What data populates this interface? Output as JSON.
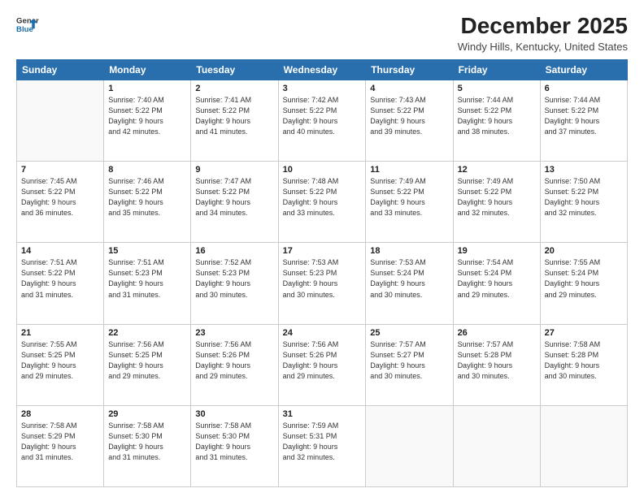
{
  "header": {
    "logo_line1": "General",
    "logo_line2": "Blue",
    "month_title": "December 2025",
    "location": "Windy Hills, Kentucky, United States"
  },
  "days_of_week": [
    "Sunday",
    "Monday",
    "Tuesday",
    "Wednesday",
    "Thursday",
    "Friday",
    "Saturday"
  ],
  "weeks": [
    [
      {
        "day": "",
        "content": ""
      },
      {
        "day": "1",
        "content": "Sunrise: 7:40 AM\nSunset: 5:22 PM\nDaylight: 9 hours\nand 42 minutes."
      },
      {
        "day": "2",
        "content": "Sunrise: 7:41 AM\nSunset: 5:22 PM\nDaylight: 9 hours\nand 41 minutes."
      },
      {
        "day": "3",
        "content": "Sunrise: 7:42 AM\nSunset: 5:22 PM\nDaylight: 9 hours\nand 40 minutes."
      },
      {
        "day": "4",
        "content": "Sunrise: 7:43 AM\nSunset: 5:22 PM\nDaylight: 9 hours\nand 39 minutes."
      },
      {
        "day": "5",
        "content": "Sunrise: 7:44 AM\nSunset: 5:22 PM\nDaylight: 9 hours\nand 38 minutes."
      },
      {
        "day": "6",
        "content": "Sunrise: 7:44 AM\nSunset: 5:22 PM\nDaylight: 9 hours\nand 37 minutes."
      }
    ],
    [
      {
        "day": "7",
        "content": "Sunrise: 7:45 AM\nSunset: 5:22 PM\nDaylight: 9 hours\nand 36 minutes."
      },
      {
        "day": "8",
        "content": "Sunrise: 7:46 AM\nSunset: 5:22 PM\nDaylight: 9 hours\nand 35 minutes."
      },
      {
        "day": "9",
        "content": "Sunrise: 7:47 AM\nSunset: 5:22 PM\nDaylight: 9 hours\nand 34 minutes."
      },
      {
        "day": "10",
        "content": "Sunrise: 7:48 AM\nSunset: 5:22 PM\nDaylight: 9 hours\nand 33 minutes."
      },
      {
        "day": "11",
        "content": "Sunrise: 7:49 AM\nSunset: 5:22 PM\nDaylight: 9 hours\nand 33 minutes."
      },
      {
        "day": "12",
        "content": "Sunrise: 7:49 AM\nSunset: 5:22 PM\nDaylight: 9 hours\nand 32 minutes."
      },
      {
        "day": "13",
        "content": "Sunrise: 7:50 AM\nSunset: 5:22 PM\nDaylight: 9 hours\nand 32 minutes."
      }
    ],
    [
      {
        "day": "14",
        "content": "Sunrise: 7:51 AM\nSunset: 5:22 PM\nDaylight: 9 hours\nand 31 minutes."
      },
      {
        "day": "15",
        "content": "Sunrise: 7:51 AM\nSunset: 5:23 PM\nDaylight: 9 hours\nand 31 minutes."
      },
      {
        "day": "16",
        "content": "Sunrise: 7:52 AM\nSunset: 5:23 PM\nDaylight: 9 hours\nand 30 minutes."
      },
      {
        "day": "17",
        "content": "Sunrise: 7:53 AM\nSunset: 5:23 PM\nDaylight: 9 hours\nand 30 minutes."
      },
      {
        "day": "18",
        "content": "Sunrise: 7:53 AM\nSunset: 5:24 PM\nDaylight: 9 hours\nand 30 minutes."
      },
      {
        "day": "19",
        "content": "Sunrise: 7:54 AM\nSunset: 5:24 PM\nDaylight: 9 hours\nand 29 minutes."
      },
      {
        "day": "20",
        "content": "Sunrise: 7:55 AM\nSunset: 5:24 PM\nDaylight: 9 hours\nand 29 minutes."
      }
    ],
    [
      {
        "day": "21",
        "content": "Sunrise: 7:55 AM\nSunset: 5:25 PM\nDaylight: 9 hours\nand 29 minutes."
      },
      {
        "day": "22",
        "content": "Sunrise: 7:56 AM\nSunset: 5:25 PM\nDaylight: 9 hours\nand 29 minutes."
      },
      {
        "day": "23",
        "content": "Sunrise: 7:56 AM\nSunset: 5:26 PM\nDaylight: 9 hours\nand 29 minutes."
      },
      {
        "day": "24",
        "content": "Sunrise: 7:56 AM\nSunset: 5:26 PM\nDaylight: 9 hours\nand 29 minutes."
      },
      {
        "day": "25",
        "content": "Sunrise: 7:57 AM\nSunset: 5:27 PM\nDaylight: 9 hours\nand 30 minutes."
      },
      {
        "day": "26",
        "content": "Sunrise: 7:57 AM\nSunset: 5:28 PM\nDaylight: 9 hours\nand 30 minutes."
      },
      {
        "day": "27",
        "content": "Sunrise: 7:58 AM\nSunset: 5:28 PM\nDaylight: 9 hours\nand 30 minutes."
      }
    ],
    [
      {
        "day": "28",
        "content": "Sunrise: 7:58 AM\nSunset: 5:29 PM\nDaylight: 9 hours\nand 31 minutes."
      },
      {
        "day": "29",
        "content": "Sunrise: 7:58 AM\nSunset: 5:30 PM\nDaylight: 9 hours\nand 31 minutes."
      },
      {
        "day": "30",
        "content": "Sunrise: 7:58 AM\nSunset: 5:30 PM\nDaylight: 9 hours\nand 31 minutes."
      },
      {
        "day": "31",
        "content": "Sunrise: 7:59 AM\nSunset: 5:31 PM\nDaylight: 9 hours\nand 32 minutes."
      },
      {
        "day": "",
        "content": ""
      },
      {
        "day": "",
        "content": ""
      },
      {
        "day": "",
        "content": ""
      }
    ]
  ]
}
